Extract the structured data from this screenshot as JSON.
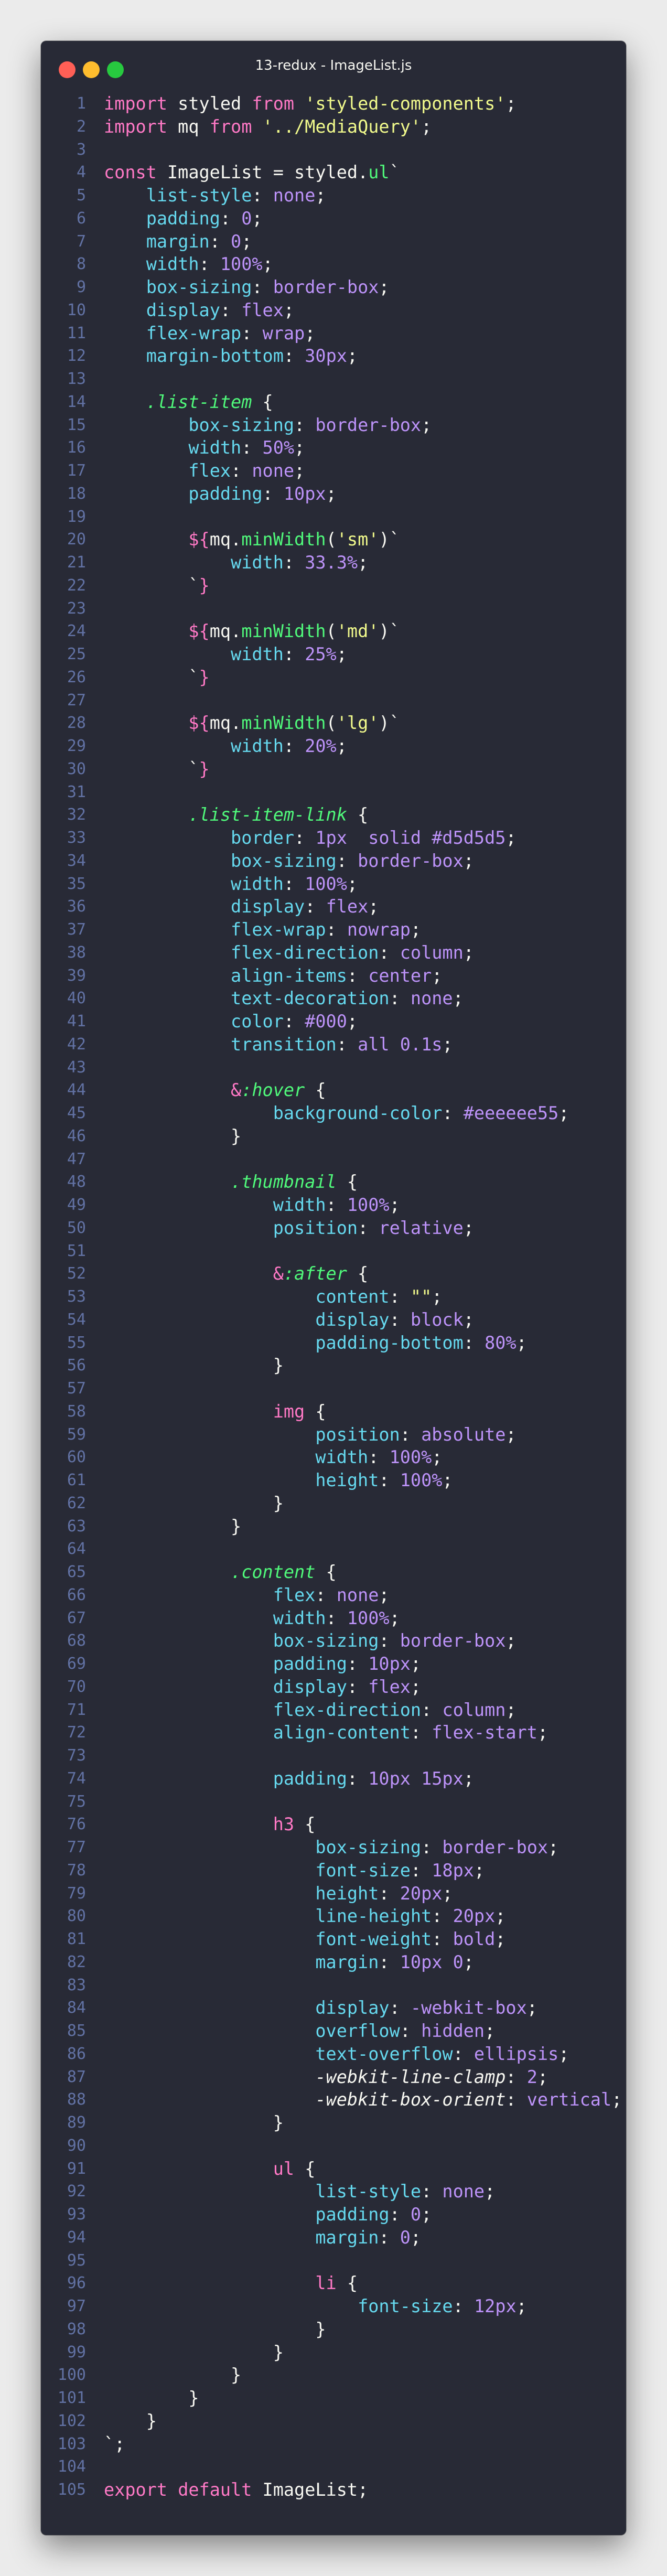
{
  "window": {
    "title": "13-redux - ImageList.js"
  },
  "colors": {
    "background": "#282a36",
    "foreground": "#f8f8f2",
    "line_number": "#6272a4",
    "keyword": "#ff79c6",
    "string": "#f1fa8c",
    "property": "#66d9ef",
    "value": "#bd93f9",
    "function": "#50fa7b",
    "traffic_red": "#ff5f56",
    "traffic_yellow": "#ffbd2e",
    "traffic_green": "#27c93f"
  },
  "code_lines": [
    [
      [
        "k",
        "import"
      ],
      [
        "",
        "  styled "
      ],
      [
        "k",
        "from"
      ],
      [
        "s",
        " 'styled-components'"
      ],
      [
        "",
        ";"
      ]
    ],
    [
      [
        "k",
        "import"
      ],
      [
        "",
        ""
      ],
      [
        "",
        "  mq "
      ],
      [
        "k",
        "from"
      ],
      [
        "s",
        " '../MediaQuery'"
      ],
      [
        "",
        ";"
      ]
    ],
    [],
    [
      [
        "k",
        "const"
      ],
      [
        "",
        " ImageList = styled."
      ],
      [
        "f",
        "ul"
      ],
      [
        "",
        "`"
      ]
    ],
    [
      [
        "",
        "    "
      ],
      [
        "p",
        "list-style"
      ],
      [
        "",
        ": "
      ],
      [
        "v",
        "none"
      ],
      [
        "",
        ";"
      ]
    ],
    [
      [
        "",
        "    "
      ],
      [
        "p",
        "padding"
      ],
      [
        "",
        ": "
      ],
      [
        "v",
        "0"
      ],
      [
        "",
        ";"
      ]
    ],
    [
      [
        "",
        "    "
      ],
      [
        "p",
        "margin"
      ],
      [
        "",
        ": "
      ],
      [
        "v",
        "0"
      ],
      [
        "",
        ";"
      ]
    ],
    [
      [
        "",
        "    "
      ],
      [
        "p",
        "width"
      ],
      [
        "",
        ": "
      ],
      [
        "v",
        "100%"
      ],
      [
        "",
        ";"
      ]
    ],
    [
      [
        "",
        "    "
      ],
      [
        "p",
        "box-sizing"
      ],
      [
        "",
        ": "
      ],
      [
        "v",
        "border-box"
      ],
      [
        "",
        ";"
      ]
    ],
    [
      [
        "",
        "    "
      ],
      [
        "p",
        "display"
      ],
      [
        "",
        ": "
      ],
      [
        "v",
        "flex"
      ],
      [
        "",
        ";"
      ]
    ],
    [
      [
        "",
        "    "
      ],
      [
        "p",
        "flex-wrap"
      ],
      [
        "",
        ": "
      ],
      [
        "v",
        "wrap"
      ],
      [
        "",
        ";"
      ]
    ],
    [
      [
        "",
        "    "
      ],
      [
        "p",
        "margin-bottom"
      ],
      [
        "",
        ": "
      ],
      [
        "v",
        "30px"
      ],
      [
        "",
        ";"
      ]
    ],
    [],
    [
      [
        "",
        "    "
      ],
      [
        "fi",
        ".list-item"
      ],
      [
        "",
        " {"
      ]
    ],
    [
      [
        "",
        "        "
      ],
      [
        "p",
        "box-sizing"
      ],
      [
        "",
        ": "
      ],
      [
        "v",
        "border-box"
      ],
      [
        "",
        ";"
      ]
    ],
    [
      [
        "",
        "        "
      ],
      [
        "p",
        "width"
      ],
      [
        "",
        ": "
      ],
      [
        "v",
        "50%"
      ],
      [
        "",
        ";"
      ]
    ],
    [
      [
        "",
        "        "
      ],
      [
        "p",
        "flex"
      ],
      [
        "",
        ": "
      ],
      [
        "v",
        "none"
      ],
      [
        "",
        ";"
      ]
    ],
    [
      [
        "",
        "        "
      ],
      [
        "p",
        "padding"
      ],
      [
        "",
        ": "
      ],
      [
        "v",
        "10px"
      ],
      [
        "",
        ";"
      ]
    ],
    [],
    [
      [
        "",
        "        "
      ],
      [
        "k",
        "${"
      ],
      [
        "",
        "mq."
      ],
      [
        "f",
        "minWidth"
      ],
      [
        "",
        "("
      ],
      [
        "s",
        "'sm'"
      ],
      [
        "",
        ")`"
      ]
    ],
    [
      [
        "",
        "            "
      ],
      [
        "p",
        "width"
      ],
      [
        "",
        ": "
      ],
      [
        "v",
        "33.3%"
      ],
      [
        "",
        ";"
      ]
    ],
    [
      [
        "",
        "        "
      ],
      [
        "",
        "`"
      ],
      [
        "k",
        "}"
      ]
    ],
    [],
    [
      [
        "",
        "        "
      ],
      [
        "k",
        "${"
      ],
      [
        "",
        "mq."
      ],
      [
        "f",
        "minWidth"
      ],
      [
        "",
        "("
      ],
      [
        "s",
        "'md'"
      ],
      [
        "",
        ")`"
      ]
    ],
    [
      [
        "",
        "            "
      ],
      [
        "p",
        "width"
      ],
      [
        "",
        ": "
      ],
      [
        "v",
        "25%"
      ],
      [
        "",
        ";"
      ]
    ],
    [
      [
        "",
        "        "
      ],
      [
        "",
        "`"
      ],
      [
        "k",
        "}"
      ]
    ],
    [],
    [
      [
        "",
        "        "
      ],
      [
        "k",
        "${"
      ],
      [
        "",
        "mq."
      ],
      [
        "f",
        "minWidth"
      ],
      [
        "",
        "("
      ],
      [
        "s",
        "'lg'"
      ],
      [
        "",
        ")`"
      ]
    ],
    [
      [
        "",
        "            "
      ],
      [
        "p",
        "width"
      ],
      [
        "",
        ": "
      ],
      [
        "v",
        "20%"
      ],
      [
        "",
        ";"
      ]
    ],
    [
      [
        "",
        "        "
      ],
      [
        "",
        "`"
      ],
      [
        "k",
        "}"
      ]
    ],
    [],
    [
      [
        "",
        "        "
      ],
      [
        "fi",
        ".list-item-link"
      ],
      [
        "",
        " {"
      ]
    ],
    [
      [
        "",
        "            "
      ],
      [
        "p",
        "border"
      ],
      [
        "",
        ": "
      ],
      [
        "v",
        "1px"
      ],
      [
        "",
        ""
      ],
      [
        "",
        "  "
      ],
      [
        "v",
        "solid #d5d5d5"
      ],
      [
        "",
        ";"
      ]
    ],
    [
      [
        "",
        "            "
      ],
      [
        "p",
        "box-sizing"
      ],
      [
        "",
        ": "
      ],
      [
        "v",
        "border-box"
      ],
      [
        "",
        ";"
      ]
    ],
    [
      [
        "",
        "            "
      ],
      [
        "p",
        "width"
      ],
      [
        "",
        ": "
      ],
      [
        "v",
        "100%"
      ],
      [
        "",
        ";"
      ]
    ],
    [
      [
        "",
        "            "
      ],
      [
        "p",
        "display"
      ],
      [
        "",
        ": "
      ],
      [
        "v",
        "flex"
      ],
      [
        "",
        ";"
      ]
    ],
    [
      [
        "",
        "            "
      ],
      [
        "p",
        "flex-wrap"
      ],
      [
        "",
        ": "
      ],
      [
        "v",
        "nowrap"
      ],
      [
        "",
        ";"
      ]
    ],
    [
      [
        "",
        "            "
      ],
      [
        "p",
        "flex-direction"
      ],
      [
        "",
        ": "
      ],
      [
        "v",
        "column"
      ],
      [
        "",
        ";"
      ]
    ],
    [
      [
        "",
        "            "
      ],
      [
        "p",
        "align-items"
      ],
      [
        "",
        ": "
      ],
      [
        "v",
        "center"
      ],
      [
        "",
        ";"
      ]
    ],
    [
      [
        "",
        "            "
      ],
      [
        "p",
        "text-decoration"
      ],
      [
        "",
        ": "
      ],
      [
        "v",
        "none"
      ],
      [
        "",
        ";"
      ]
    ],
    [
      [
        "",
        "            "
      ],
      [
        "p",
        "color"
      ],
      [
        "",
        ": "
      ],
      [
        "v",
        "#000"
      ],
      [
        "",
        ";"
      ]
    ],
    [
      [
        "",
        "            "
      ],
      [
        "p",
        "transition"
      ],
      [
        "",
        ": "
      ],
      [
        "v",
        "all 0.1s"
      ],
      [
        "",
        ";"
      ]
    ],
    [],
    [
      [
        "",
        "            "
      ],
      [
        "k",
        "&"
      ],
      [
        "fi",
        ":hover"
      ],
      [
        "",
        " {"
      ]
    ],
    [
      [
        "",
        "                "
      ],
      [
        "p",
        "background-color"
      ],
      [
        "",
        ": "
      ],
      [
        "v",
        "#eeeeee55"
      ],
      [
        "",
        ";"
      ]
    ],
    [
      [
        "",
        "            "
      ],
      [
        "",
        "}"
      ]
    ],
    [],
    [
      [
        "",
        "            "
      ],
      [
        "fi",
        ".thumbnail"
      ],
      [
        "",
        " {"
      ]
    ],
    [
      [
        "",
        "                "
      ],
      [
        "p",
        "width"
      ],
      [
        "",
        ": "
      ],
      [
        "v",
        "100%"
      ],
      [
        "",
        ";"
      ]
    ],
    [
      [
        "",
        "                "
      ],
      [
        "p",
        "position"
      ],
      [
        "",
        ": "
      ],
      [
        "v",
        "relative"
      ],
      [
        "",
        ";"
      ]
    ],
    [],
    [
      [
        "",
        "                "
      ],
      [
        "k",
        "&"
      ],
      [
        "fi",
        ":after"
      ],
      [
        "",
        " {"
      ]
    ],
    [
      [
        "",
        "                    "
      ],
      [
        "p",
        "content"
      ],
      [
        "",
        ": "
      ],
      [
        "s",
        "\"\""
      ],
      [
        "",
        ";"
      ]
    ],
    [
      [
        "",
        "                    "
      ],
      [
        "p",
        "display"
      ],
      [
        "",
        ": "
      ],
      [
        "v",
        "block"
      ],
      [
        "",
        ";"
      ]
    ],
    [
      [
        "",
        "                    "
      ],
      [
        "p",
        "padding-bottom"
      ],
      [
        "",
        ": "
      ],
      [
        "v",
        "80%"
      ],
      [
        "",
        ";"
      ]
    ],
    [
      [
        "",
        "                "
      ],
      [
        "",
        "}"
      ]
    ],
    [],
    [
      [
        "",
        "                "
      ],
      [
        "k",
        "img"
      ],
      [
        "",
        " {"
      ]
    ],
    [
      [
        "",
        "                    "
      ],
      [
        "p",
        "position"
      ],
      [
        "",
        ": "
      ],
      [
        "v",
        "absolute"
      ],
      [
        "",
        ";"
      ]
    ],
    [
      [
        "",
        "                    "
      ],
      [
        "p",
        "width"
      ],
      [
        "",
        ": "
      ],
      [
        "v",
        "100%"
      ],
      [
        "",
        ";"
      ]
    ],
    [
      [
        "",
        "                    "
      ],
      [
        "p",
        "height"
      ],
      [
        "",
        ": "
      ],
      [
        "v",
        "100%"
      ],
      [
        "",
        ";"
      ]
    ],
    [
      [
        "",
        "                "
      ],
      [
        "",
        "}"
      ]
    ],
    [
      [
        "",
        "            "
      ],
      [
        "",
        "}"
      ]
    ],
    [],
    [
      [
        "",
        "            "
      ],
      [
        "fi",
        ".content"
      ],
      [
        "",
        " {"
      ]
    ],
    [
      [
        "",
        "                "
      ],
      [
        "p",
        "flex"
      ],
      [
        "",
        ": "
      ],
      [
        "v",
        "none"
      ],
      [
        "",
        ";"
      ]
    ],
    [
      [
        "",
        "                "
      ],
      [
        "p",
        "width"
      ],
      [
        "",
        ": "
      ],
      [
        "v",
        "100%"
      ],
      [
        "",
        ";"
      ]
    ],
    [
      [
        "",
        "                "
      ],
      [
        "p",
        "box-sizing"
      ],
      [
        "",
        ": "
      ],
      [
        "v",
        "border-box"
      ],
      [
        "",
        ";"
      ]
    ],
    [
      [
        "",
        "                "
      ],
      [
        "p",
        "padding"
      ],
      [
        "",
        ": "
      ],
      [
        "v",
        "10px"
      ],
      [
        "",
        ";"
      ]
    ],
    [
      [
        "",
        "                "
      ],
      [
        "p",
        "display"
      ],
      [
        "",
        ": "
      ],
      [
        "v",
        "flex"
      ],
      [
        "",
        ";"
      ]
    ],
    [
      [
        "",
        "                "
      ],
      [
        "p",
        "flex-direction"
      ],
      [
        "",
        ": "
      ],
      [
        "v",
        "column"
      ],
      [
        "",
        ";"
      ]
    ],
    [
      [
        "",
        "                "
      ],
      [
        "p",
        "align-content"
      ],
      [
        "",
        ": "
      ],
      [
        "v",
        "flex-start"
      ],
      [
        "",
        ";"
      ]
    ],
    [],
    [
      [
        "",
        "                "
      ],
      [
        "p",
        "padding"
      ],
      [
        "",
        ": "
      ],
      [
        "v",
        "10px 15px"
      ],
      [
        "",
        ";"
      ]
    ],
    [],
    [
      [
        "",
        "                "
      ],
      [
        "k",
        "h3"
      ],
      [
        "",
        " {"
      ]
    ],
    [
      [
        "",
        "                    "
      ],
      [
        "p",
        "box-sizing"
      ],
      [
        "",
        ": "
      ],
      [
        "v",
        "border-box"
      ],
      [
        "",
        ";"
      ]
    ],
    [
      [
        "",
        "                    "
      ],
      [
        "p",
        "font-size"
      ],
      [
        "",
        ": "
      ],
      [
        "v",
        "18px"
      ],
      [
        "",
        ";"
      ]
    ],
    [
      [
        "",
        "                    "
      ],
      [
        "p",
        "height"
      ],
      [
        "",
        ": "
      ],
      [
        "v",
        "20px"
      ],
      [
        "",
        ";"
      ]
    ],
    [
      [
        "",
        "                    "
      ],
      [
        "p",
        "line-height"
      ],
      [
        "",
        ": "
      ],
      [
        "v",
        "20px"
      ],
      [
        "",
        ";"
      ]
    ],
    [
      [
        "",
        "                    "
      ],
      [
        "p",
        "font-weight"
      ],
      [
        "",
        ": "
      ],
      [
        "v",
        "bold"
      ],
      [
        "",
        ";"
      ]
    ],
    [
      [
        "",
        "                    "
      ],
      [
        "p",
        "margin"
      ],
      [
        "",
        ": "
      ],
      [
        "v",
        "10px 0"
      ],
      [
        "",
        ";"
      ]
    ],
    [],
    [
      [
        "",
        "                    "
      ],
      [
        "p",
        "display"
      ],
      [
        "",
        ": "
      ],
      [
        "v",
        "-webkit-box"
      ],
      [
        "",
        ";"
      ]
    ],
    [
      [
        "",
        "                    "
      ],
      [
        "p",
        "overflow"
      ],
      [
        "",
        ": "
      ],
      [
        "v",
        "hidden"
      ],
      [
        "",
        ";"
      ]
    ],
    [
      [
        "",
        "                    "
      ],
      [
        "p",
        "text-overflow"
      ],
      [
        "",
        ": "
      ],
      [
        "v",
        "ellipsis"
      ],
      [
        "",
        ";"
      ]
    ],
    [
      [
        "",
        "                    "
      ],
      [
        "it",
        "-webkit-line-clamp"
      ],
      [
        "",
        ": "
      ],
      [
        "v",
        "2"
      ],
      [
        "",
        ";"
      ]
    ],
    [
      [
        "",
        "                    "
      ],
      [
        "it",
        "-webkit-box-orient"
      ],
      [
        "",
        ": "
      ],
      [
        "v",
        "vertical"
      ],
      [
        "",
        ";"
      ]
    ],
    [
      [
        "",
        "                "
      ],
      [
        "",
        "}"
      ]
    ],
    [],
    [
      [
        "",
        "                "
      ],
      [
        "k",
        "ul"
      ],
      [
        "",
        " {"
      ]
    ],
    [
      [
        "",
        "                    "
      ],
      [
        "p",
        "list-style"
      ],
      [
        "",
        ": "
      ],
      [
        "v",
        "none"
      ],
      [
        "",
        ";"
      ]
    ],
    [
      [
        "",
        "                    "
      ],
      [
        "p",
        "padding"
      ],
      [
        "",
        ": "
      ],
      [
        "v",
        "0"
      ],
      [
        "",
        ";"
      ]
    ],
    [
      [
        "",
        "                    "
      ],
      [
        "p",
        "margin"
      ],
      [
        "",
        ": "
      ],
      [
        "v",
        "0"
      ],
      [
        "",
        ";"
      ]
    ],
    [],
    [
      [
        "",
        "                    "
      ],
      [
        "k",
        "li"
      ],
      [
        "",
        " {"
      ]
    ],
    [
      [
        "",
        "                        "
      ],
      [
        "p",
        "font-size"
      ],
      [
        "",
        ": "
      ],
      [
        "v",
        "12px"
      ],
      [
        "",
        ";"
      ]
    ],
    [
      [
        "",
        "                    "
      ],
      [
        "",
        "}"
      ]
    ],
    [
      [
        "",
        "                "
      ],
      [
        "",
        "}"
      ]
    ],
    [
      [
        "",
        "            "
      ],
      [
        "",
        "}"
      ]
    ],
    [
      [
        "",
        "        "
      ],
      [
        "",
        "}"
      ]
    ],
    [
      [
        "",
        "    "
      ],
      [
        "",
        "}"
      ]
    ],
    [
      [
        "",
        "`;"
      ]
    ],
    [],
    [
      [
        "k",
        "export"
      ],
      [
        "",
        ""
      ],
      [
        "",
        " "
      ],
      [
        "k",
        "default"
      ],
      [
        "",
        " ImageList;"
      ]
    ]
  ]
}
